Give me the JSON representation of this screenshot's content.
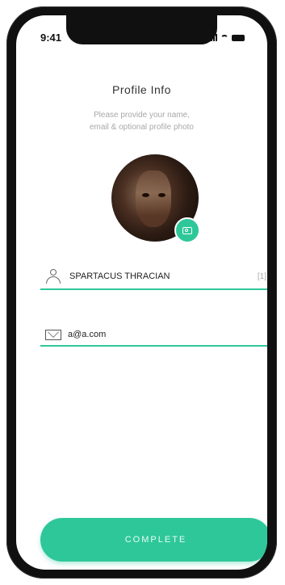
{
  "status_bar": {
    "time": "9:41"
  },
  "header": {
    "title": "Profile Info",
    "subtitle_line1": "Please provide your name,",
    "subtitle_line2": "email & optional profile photo"
  },
  "avatar": {
    "camera_icon": "camera-icon"
  },
  "form": {
    "name_value": "SPARTACUS THRACIAN",
    "name_counter": "[1]",
    "email_value": "a@a.com"
  },
  "actions": {
    "complete_label": "COMPLETE"
  },
  "colors": {
    "accent": "#2ec79a",
    "frame": "#101010"
  }
}
